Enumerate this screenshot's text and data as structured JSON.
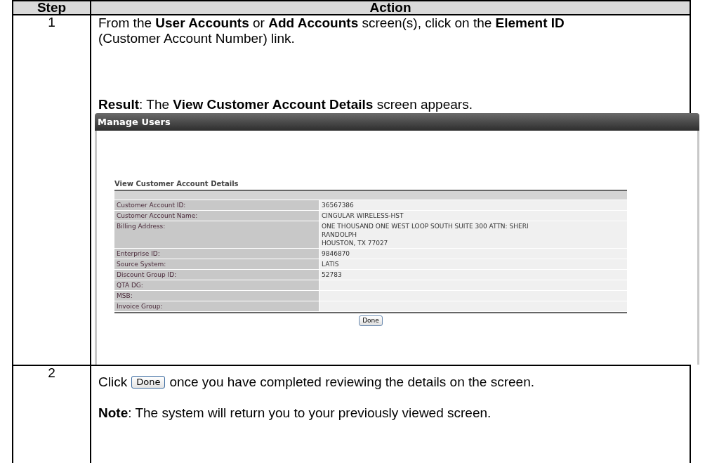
{
  "table": {
    "columns": [
      "Step",
      "Action"
    ],
    "rows": [
      {
        "step": "1",
        "instruction": "From the **User Accounts** or **Add Accounts** screen(s), click on the **Element ID** (Customer Account Number) link.",
        "result": "**Result**:  The **View Customer Account Details** screen appears.",
        "screenshot": {
          "title": "Manage Users",
          "heading": "View Customer Account Details",
          "fields": [
            {
              "label": "Customer Account ID:",
              "value": [
                "36567386"
              ]
            },
            {
              "label": "Customer Account Name:",
              "value": [
                "CINGULAR WIRELESS-HST"
              ]
            },
            {
              "label": "Billing Address:",
              "value": [
                "ONE THOUSAND ONE WEST LOOP SOUTH SUITE 300 ATTN: SHERI",
                "RANDOLPH",
                "HOUSTON, TX 77027"
              ]
            },
            {
              "label": "Enterprise ID:",
              "value": [
                "9846870"
              ]
            },
            {
              "label": "Source System:",
              "value": [
                "LATIS"
              ]
            },
            {
              "label": "Discount Group ID:",
              "value": [
                "52783"
              ]
            },
            {
              "label": "QTA DG:"
            },
            {
              "label": "MSB:"
            },
            {
              "label": "Invoice Group:"
            }
          ],
          "button": "Done"
        }
      },
      {
        "step": "2",
        "click": "Click",
        "button": "Done",
        "after": "once you have completed reviewing the details on the screen.",
        "note": "**Note**:  The system will return you to your previously viewed screen."
      }
    ]
  }
}
